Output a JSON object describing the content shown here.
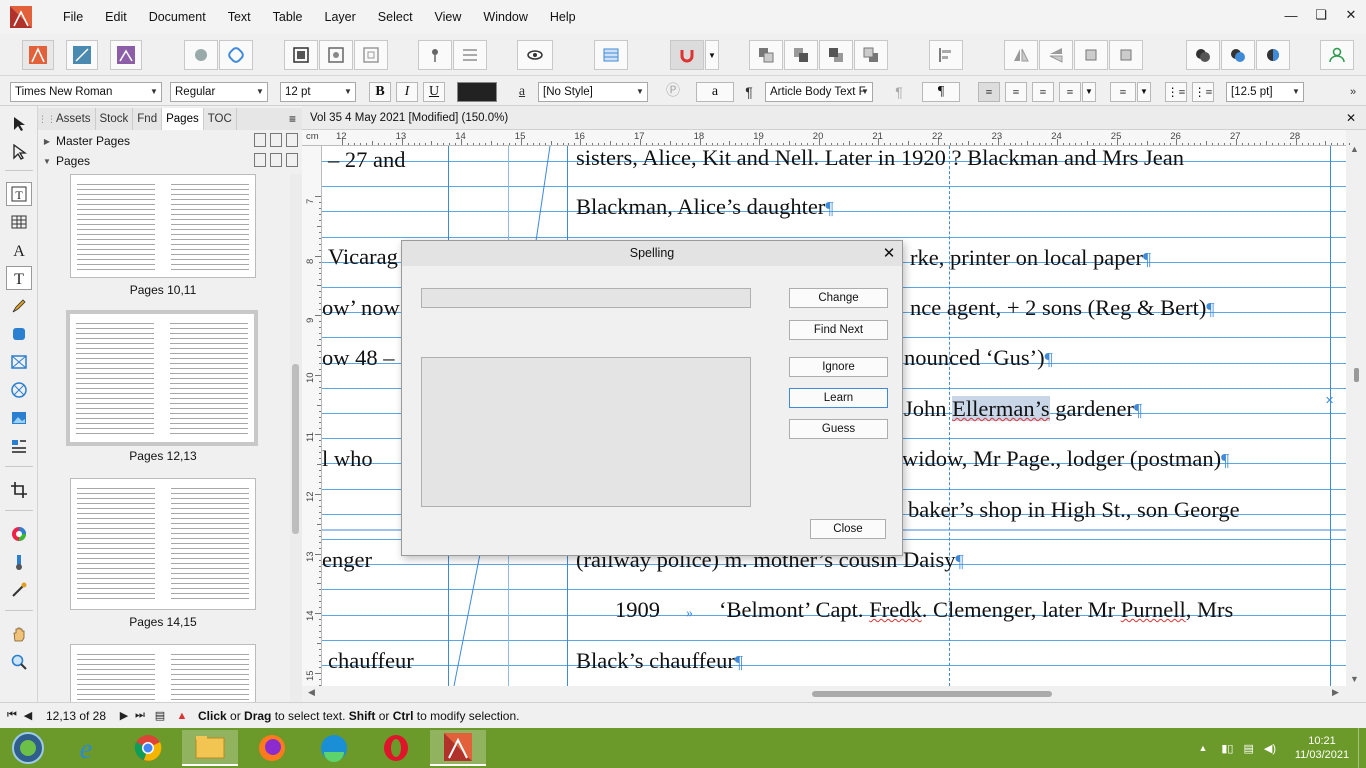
{
  "menubar": {
    "items": [
      "File",
      "Edit",
      "Document",
      "Text",
      "Table",
      "Layer",
      "Select",
      "View",
      "Window",
      "Help"
    ]
  },
  "context_toolbar": {
    "font_family": "Times New Roman",
    "font_style": "Regular",
    "font_size": "12 pt",
    "bold": "B",
    "italic": "I",
    "underline": "U",
    "text_style": "[No Style]",
    "paragraph_style": "Article Body Text F",
    "leading": "[12.5 pt]",
    "fill_color": "#222222"
  },
  "panel": {
    "tabs": [
      "Assets",
      "Stock",
      "Fnd",
      "Pages",
      "TOC"
    ],
    "active_tab": "Pages",
    "sections": [
      "Master Pages",
      "Pages"
    ],
    "thumbnails": [
      {
        "label": "Pages 10,11"
      },
      {
        "label": "Pages 12,13"
      },
      {
        "label": "Pages 14,15"
      },
      {
        "label": ""
      }
    ]
  },
  "document": {
    "title": "Vol 35 4 May 2021 [Modified] (150.0%)",
    "ruler_unit": "cm",
    "ruler_h_labels": [
      "12",
      "13",
      "14",
      "15",
      "16",
      "17",
      "18",
      "19",
      "20",
      "21",
      "22",
      "23",
      "24",
      "25",
      "26",
      "27",
      "28"
    ],
    "ruler_v_labels": [
      "7",
      "8",
      "9",
      "10",
      "11",
      "12",
      "13",
      "14",
      "15"
    ],
    "left_fragments": [
      "– 27 and",
      "Vicarag",
      "ow’ now",
      "ow 48 –",
      "l who",
      "enger",
      "chauffeur"
    ],
    "lines": {
      "l1": "sisters, Alice, Kit and Nell. Later in 1920 ? Blackman and Mrs Jean",
      "l2": "Blackman, Alice’s daughter",
      "l3": "rke, printer on local paper",
      "l4": "nce agent, + 2 sons (Reg & Bert)",
      "l5": "nounced ‘Gus’)",
      "l6a": "John ",
      "l6b": "Ellerman’s",
      "l6c": " gardener",
      "l7": "widow, Mr Page., lodger (postman)",
      "l8": "baker’s shop in High St., son George",
      "l9": "(railway police) m. mother’s cousin Daisy",
      "l10a": "1909",
      "l10b": "‘Belmont’ Capt. ",
      "l10c": "Fredk",
      "l10d": ". Clemenger, later Mr ",
      "l10e": "Purnell",
      "l10f": ", Mrs",
      "l11": "Black’s chauffeur"
    }
  },
  "spelling_dialog": {
    "title": "Spelling",
    "buttons": {
      "change": "Change",
      "find_next": "Find Next",
      "ignore": "Ignore",
      "learn": "Learn",
      "guess": "Guess",
      "close": "Close"
    }
  },
  "statusbar": {
    "page_counter": "12,13 of 28",
    "msg_click": "Click",
    "msg_or1": " or ",
    "msg_drag": "Drag",
    "msg_mid": " to select text. ",
    "msg_shift": "Shift",
    "msg_or2": " or ",
    "msg_ctrl": "Ctrl",
    "msg_end": " to modify selection."
  },
  "taskbar": {
    "time": "10:21",
    "date": "11/03/2021"
  },
  "colors": {
    "accent_blue": "#3f8ad9",
    "baseline_blue": "#5aa7e6",
    "taskbar_green": "#6c9a2a",
    "spell_red": "#d33333"
  }
}
